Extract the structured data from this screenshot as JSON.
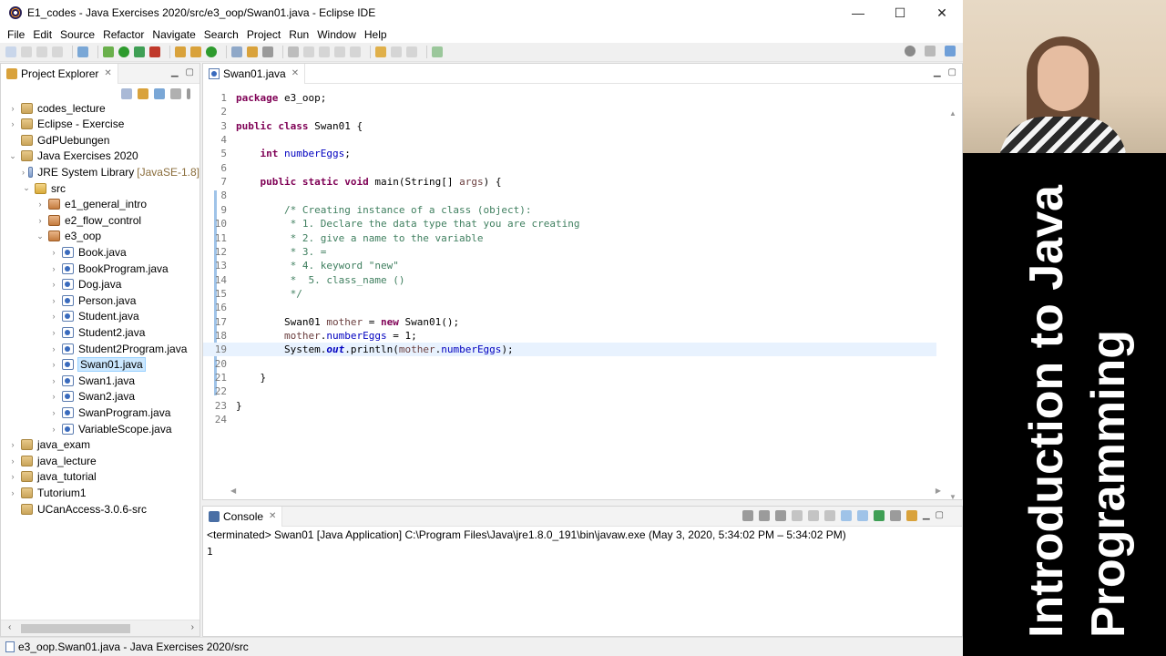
{
  "window": {
    "title": "E1_codes - Java Exercises 2020/src/e3_oop/Swan01.java - Eclipse IDE",
    "controls": {
      "minimize": "—",
      "maximize": "☐",
      "close": "✕"
    }
  },
  "menu": [
    "File",
    "Edit",
    "Source",
    "Refactor",
    "Navigate",
    "Search",
    "Project",
    "Run",
    "Window",
    "Help"
  ],
  "explorer": {
    "tab_label": "Project Explorer",
    "tree": [
      {
        "label": "codes_lecture",
        "depth": 0,
        "arrow": "›",
        "icon": "project"
      },
      {
        "label": "Eclipse - Exercise",
        "depth": 0,
        "arrow": "›",
        "icon": "project"
      },
      {
        "label": "GdPUebungen",
        "depth": 0,
        "arrow": "",
        "icon": "project"
      },
      {
        "label": "Java Exercises 2020",
        "depth": 0,
        "arrow": "⌄",
        "icon": "project"
      },
      {
        "label": "JRE System Library",
        "suffix": "[JavaSE-1.8]",
        "depth": 1,
        "arrow": "›",
        "icon": "lib"
      },
      {
        "label": "src",
        "depth": 1,
        "arrow": "⌄",
        "icon": "folder"
      },
      {
        "label": "e1_general_intro",
        "depth": 2,
        "arrow": "›",
        "icon": "package"
      },
      {
        "label": "e2_flow_control",
        "depth": 2,
        "arrow": "›",
        "icon": "package"
      },
      {
        "label": "e3_oop",
        "depth": 2,
        "arrow": "⌄",
        "icon": "package"
      },
      {
        "label": "Book.java",
        "depth": 3,
        "arrow": "›",
        "icon": "java"
      },
      {
        "label": "BookProgram.java",
        "depth": 3,
        "arrow": "›",
        "icon": "java"
      },
      {
        "label": "Dog.java",
        "depth": 3,
        "arrow": "›",
        "icon": "java"
      },
      {
        "label": "Person.java",
        "depth": 3,
        "arrow": "›",
        "icon": "java"
      },
      {
        "label": "Student.java",
        "depth": 3,
        "arrow": "›",
        "icon": "java"
      },
      {
        "label": "Student2.java",
        "depth": 3,
        "arrow": "›",
        "icon": "java"
      },
      {
        "label": "Student2Program.java",
        "depth": 3,
        "arrow": "›",
        "icon": "java"
      },
      {
        "label": "Swan01.java",
        "depth": 3,
        "arrow": "›",
        "icon": "java",
        "selected": true
      },
      {
        "label": "Swan1.java",
        "depth": 3,
        "arrow": "›",
        "icon": "java"
      },
      {
        "label": "Swan2.java",
        "depth": 3,
        "arrow": "›",
        "icon": "java"
      },
      {
        "label": "SwanProgram.java",
        "depth": 3,
        "arrow": "›",
        "icon": "java"
      },
      {
        "label": "VariableScope.java",
        "depth": 3,
        "arrow": "›",
        "icon": "java"
      },
      {
        "label": "java_exam",
        "depth": 0,
        "arrow": "›",
        "icon": "project"
      },
      {
        "label": "java_lecture",
        "depth": 0,
        "arrow": "›",
        "icon": "project"
      },
      {
        "label": "java_tutorial",
        "depth": 0,
        "arrow": "›",
        "icon": "project"
      },
      {
        "label": "Tutorium1",
        "depth": 0,
        "arrow": "›",
        "icon": "project"
      },
      {
        "label": "UCanAccess-3.0.6-src",
        "depth": 0,
        "arrow": "",
        "icon": "project"
      }
    ]
  },
  "editor": {
    "tab_label": "Swan01.java",
    "current_line": 19,
    "lines": [
      {
        "n": "1",
        "tokens": [
          [
            "kw",
            "package"
          ],
          [
            "pln",
            " e3_oop;"
          ]
        ]
      },
      {
        "n": "2",
        "tokens": []
      },
      {
        "n": "3",
        "tokens": [
          [
            "kw",
            "public"
          ],
          [
            "pln",
            " "
          ],
          [
            "kw",
            "class"
          ],
          [
            "pln",
            " Swan01 {"
          ]
        ]
      },
      {
        "n": "4",
        "tokens": []
      },
      {
        "n": "5",
        "tokens": [
          [
            "pln",
            "    "
          ],
          [
            "kw",
            "int"
          ],
          [
            "pln",
            " "
          ],
          [
            "fld",
            "numberEggs"
          ],
          [
            "pln",
            ";"
          ]
        ]
      },
      {
        "n": "6",
        "tokens": []
      },
      {
        "n": "7",
        "tokens": [
          [
            "pln",
            "    "
          ],
          [
            "kw",
            "public"
          ],
          [
            "pln",
            " "
          ],
          [
            "kw",
            "static"
          ],
          [
            "pln",
            " "
          ],
          [
            "kw",
            "void"
          ],
          [
            "pln",
            " main(String[] "
          ],
          [
            "lv",
            "args"
          ],
          [
            "pln",
            ") {"
          ]
        ]
      },
      {
        "n": "8",
        "tokens": []
      },
      {
        "n": "9",
        "tokens": [
          [
            "pln",
            "        "
          ],
          [
            "cm",
            "/* Creating instance of a class (object):"
          ]
        ]
      },
      {
        "n": "10",
        "tokens": [
          [
            "pln",
            "        "
          ],
          [
            "cm",
            " * 1. Declare the data type that you are creating"
          ]
        ]
      },
      {
        "n": "11",
        "tokens": [
          [
            "pln",
            "        "
          ],
          [
            "cm",
            " * 2. give a name to the variable"
          ]
        ]
      },
      {
        "n": "12",
        "tokens": [
          [
            "pln",
            "        "
          ],
          [
            "cm",
            " * 3. ="
          ]
        ]
      },
      {
        "n": "13",
        "tokens": [
          [
            "pln",
            "        "
          ],
          [
            "cm",
            " * 4. keyword \"new\""
          ]
        ]
      },
      {
        "n": "14",
        "tokens": [
          [
            "pln",
            "        "
          ],
          [
            "cm",
            " *  5. class_name ()"
          ]
        ]
      },
      {
        "n": "15",
        "tokens": [
          [
            "pln",
            "        "
          ],
          [
            "cm",
            " */"
          ]
        ]
      },
      {
        "n": "16",
        "tokens": []
      },
      {
        "n": "17",
        "tokens": [
          [
            "pln",
            "        Swan01 "
          ],
          [
            "lv",
            "mother"
          ],
          [
            "pln",
            " = "
          ],
          [
            "kw",
            "new"
          ],
          [
            "pln",
            " Swan01();"
          ]
        ]
      },
      {
        "n": "18",
        "tokens": [
          [
            "pln",
            "        "
          ],
          [
            "lv",
            "mother"
          ],
          [
            "pln",
            "."
          ],
          [
            "fld",
            "numberEggs"
          ],
          [
            "pln",
            " = 1;"
          ]
        ]
      },
      {
        "n": "19",
        "tokens": [
          [
            "pln",
            "        System."
          ],
          [
            "st",
            "out"
          ],
          [
            "pln",
            ".println("
          ],
          [
            "lv",
            "mother"
          ],
          [
            "pln",
            "."
          ],
          [
            "fld",
            "numberEggs"
          ],
          [
            "pln",
            ");"
          ]
        ]
      },
      {
        "n": "20",
        "tokens": []
      },
      {
        "n": "21",
        "tokens": [
          [
            "pln",
            "    }"
          ]
        ]
      },
      {
        "n": "22",
        "tokens": []
      },
      {
        "n": "23",
        "tokens": [
          [
            "pln",
            "}"
          ]
        ]
      },
      {
        "n": "24",
        "tokens": []
      }
    ]
  },
  "console": {
    "tab_label": "Console",
    "terminated": "<terminated> Swan01 [Java Application] C:\\Program Files\\Java\\jre1.8.0_191\\bin\\javaw.exe  (May 3, 2020, 5:34:02 PM – 5:34:02 PM)",
    "output": "1"
  },
  "status": {
    "text": "e3_oop.Swan01.java - Java Exercises 2020/src"
  },
  "overlay": {
    "title_line1": "Introduction to Java",
    "title_line2": "Programming"
  },
  "colors": {
    "keyword": "#7f0055",
    "comment": "#3f7f5f",
    "field": "#0000c0",
    "local_var": "#6a3e3e",
    "selection": "#cce8ff"
  }
}
